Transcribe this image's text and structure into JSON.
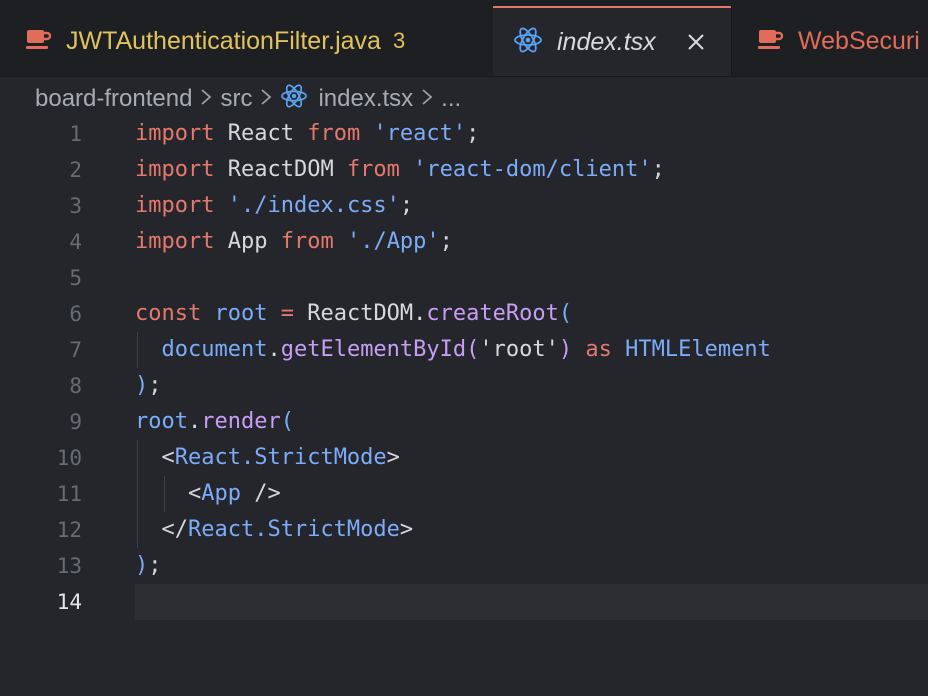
{
  "tabs": [
    {
      "label": "JWTAuthenticationFilter.java",
      "badge": "3",
      "icon": "java-cup-icon"
    },
    {
      "label": "index.tsx",
      "icon": "react-icon",
      "active": true
    },
    {
      "label": "WebSecuri",
      "icon": "java-cup-icon"
    }
  ],
  "breadcrumb": {
    "items": [
      "board-frontend",
      "src",
      "index.tsx",
      "..."
    ]
  },
  "editor": {
    "current_line": "14",
    "line_numbers": [
      "1",
      "2",
      "3",
      "4",
      "5",
      "6",
      "7",
      "8",
      "9",
      "10",
      "11",
      "12",
      "13",
      "14"
    ],
    "lines": [
      "import React from 'react';",
      "import ReactDOM from 'react-dom/client';",
      "import './index.css';",
      "import App from './App';",
      "",
      "const root = ReactDOM.createRoot(",
      "  document.getElementById('root') as HTMLElement",
      ");",
      "root.render(",
      "  <React.StrictMode>",
      "    <App />",
      "  </React.StrictMode>",
      ");",
      ""
    ]
  },
  "colors": {
    "keyword": "#e5786d",
    "string": "#7cacf8",
    "function": "#c69ff5",
    "background": "#24262c",
    "java_tab": "#e0c35c"
  }
}
